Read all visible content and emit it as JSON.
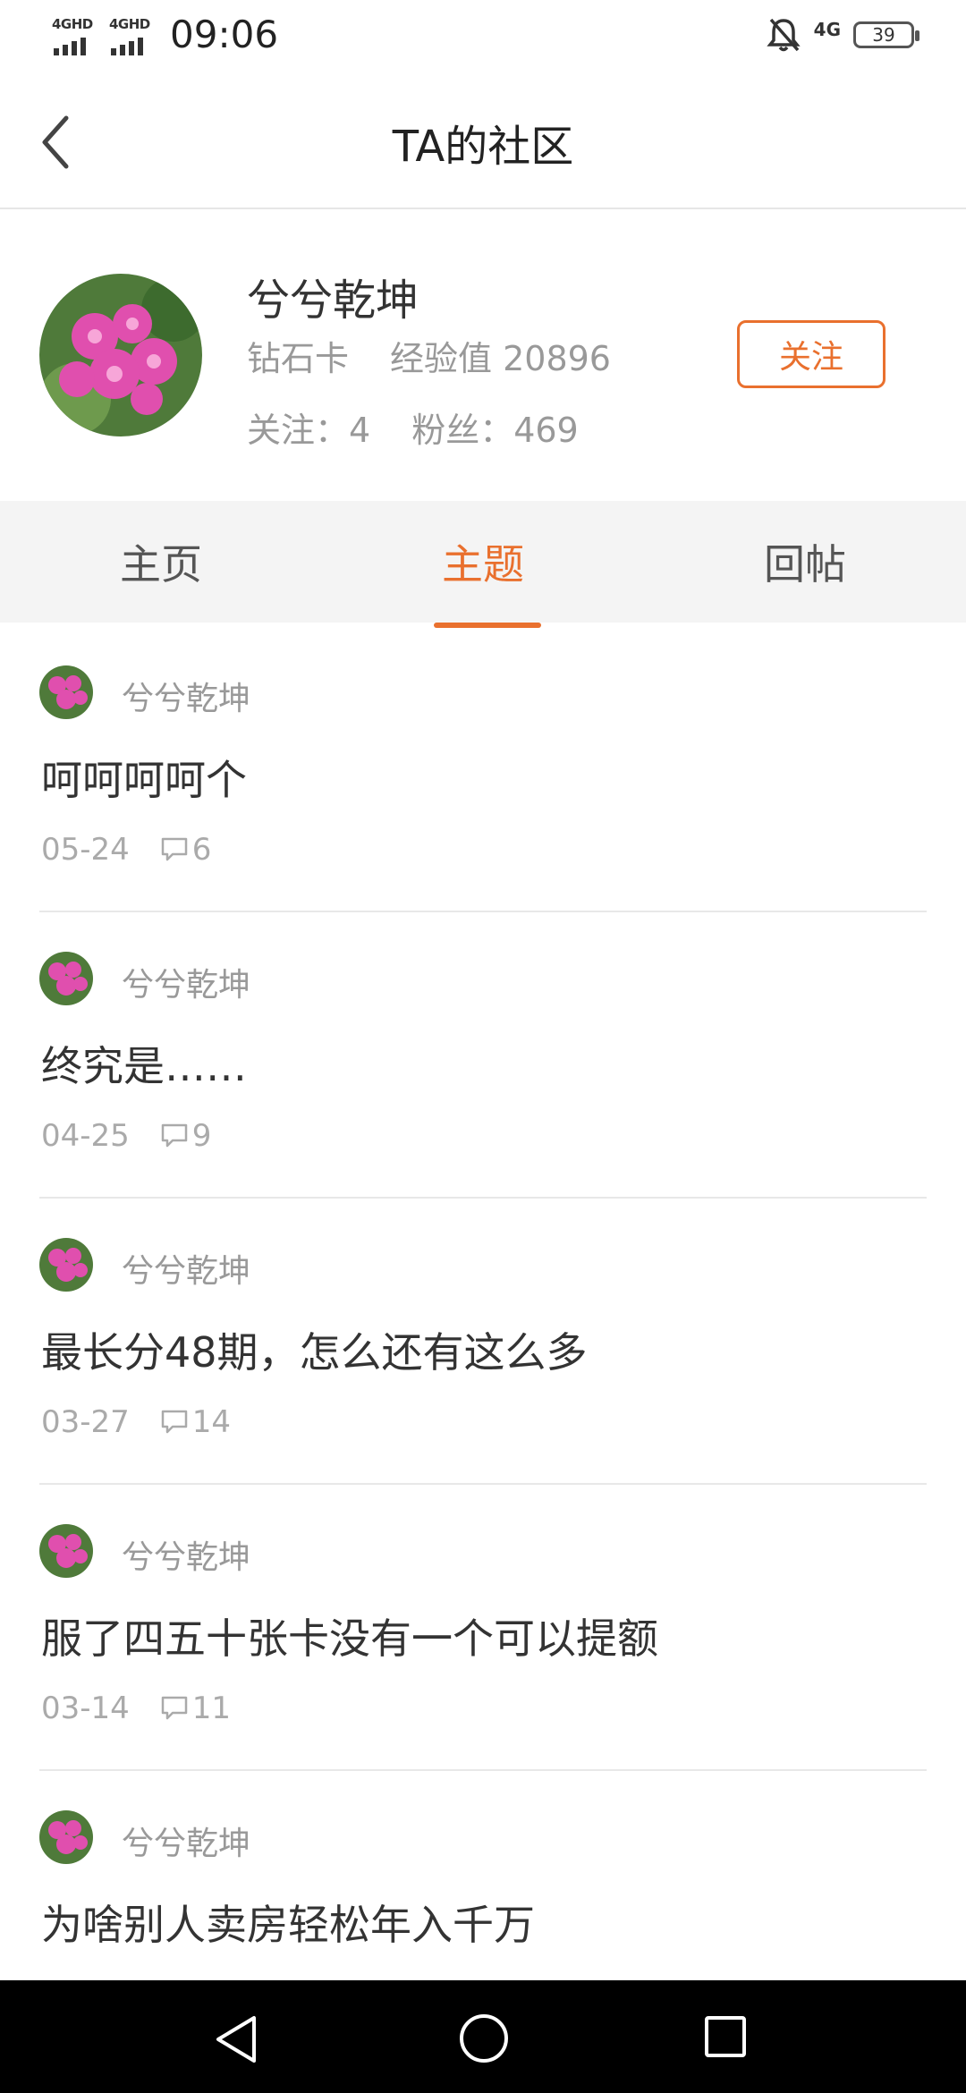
{
  "status_bar": {
    "signal1_label": "4GHD",
    "signal2_label": "4GHD",
    "time": "09:06",
    "network": "4G",
    "battery": "39",
    "icons": [
      "mute-bell-icon"
    ]
  },
  "header": {
    "title": "TA的社区",
    "back_icon": "chevron-left-icon"
  },
  "profile": {
    "username": "兮兮乾坤",
    "card_level": "钻石卡",
    "experience": "经验值 20896",
    "following": "关注：4",
    "fans": "粉丝：469",
    "follow_button": "关注"
  },
  "tabs": [
    {
      "label": "主页",
      "active": false
    },
    {
      "label": "主题",
      "active": true
    },
    {
      "label": "回帖",
      "active": false
    }
  ],
  "posts": [
    {
      "author": "兮兮乾坤",
      "title": "呵呵呵呵个",
      "date": "05-24",
      "comments": "6"
    },
    {
      "author": "兮兮乾坤",
      "title": "终究是……",
      "date": "04-25",
      "comments": "9"
    },
    {
      "author": "兮兮乾坤",
      "title": "最长分48期，怎么还有这么多",
      "date": "03-27",
      "comments": "14"
    },
    {
      "author": "兮兮乾坤",
      "title": "服了四五十张卡没有一个可以提额",
      "date": "03-14",
      "comments": "11"
    },
    {
      "author": "兮兮乾坤",
      "title": "为啥别人卖房轻松年入千万",
      "date": "",
      "comments": ""
    }
  ],
  "colors": {
    "accent": "#e9702e",
    "tab_bg": "#f4f4f4",
    "muted_text": "#999999"
  },
  "nav_bar": {
    "icons": [
      "nav-back-icon",
      "nav-home-icon",
      "nav-recents-icon"
    ]
  }
}
